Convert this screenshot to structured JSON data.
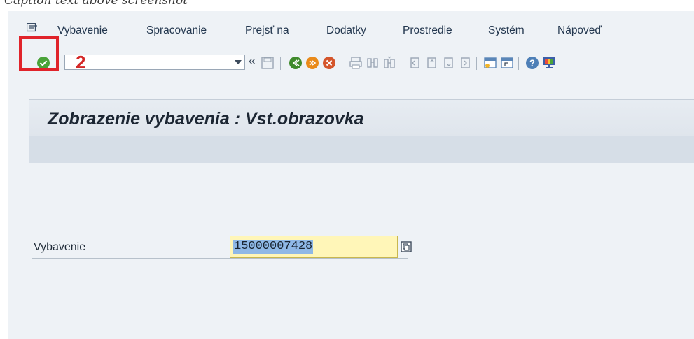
{
  "menu": {
    "items": [
      {
        "label": "Vybavenie"
      },
      {
        "label": "Spracovanie"
      },
      {
        "label": "Prejsť na"
      },
      {
        "label": "Dodatky"
      },
      {
        "label": "Prostredie"
      },
      {
        "label": "Systém"
      },
      {
        "label": "Nápoveď"
      }
    ]
  },
  "toolbar": {
    "command_field_value": "",
    "collapse_glyph": "«",
    "icons": [
      "enter-icon",
      "save-icon",
      "back-icon",
      "exit-icon",
      "cancel-icon",
      "print-icon",
      "find-icon",
      "find-next-icon",
      "first-page-icon",
      "previous-page-icon",
      "next-page-icon",
      "last-page-icon",
      "create-session-icon",
      "shortcut-icon",
      "help-icon",
      "layout-icon"
    ]
  },
  "annotation": {
    "marker": "2",
    "highlight_color": "#e0232a"
  },
  "screen": {
    "title": "Zobrazenie vybavenia : Vst.obrazovka"
  },
  "form": {
    "field_label": "Vybavenie",
    "field_value": "15000007428"
  },
  "colors": {
    "accent_input": "#fff6b8",
    "selection": "#8fb8e6"
  }
}
